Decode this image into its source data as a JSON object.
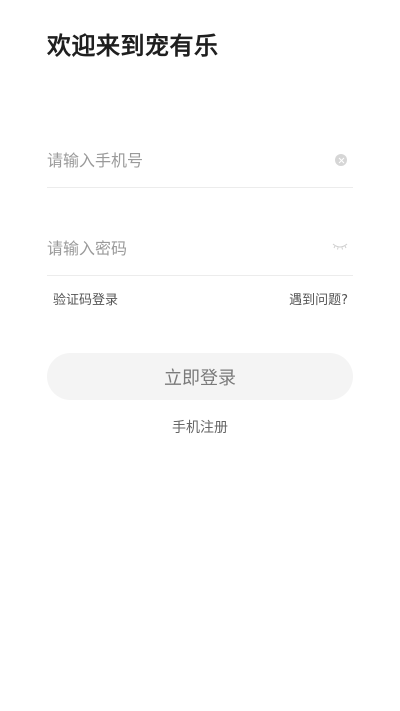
{
  "header": {
    "title": "欢迎来到宠有乐"
  },
  "form": {
    "phone": {
      "value": "",
      "placeholder": "请输入手机号",
      "clear_icon": "clear-circle-icon"
    },
    "password": {
      "value": "",
      "placeholder": "请输入密码",
      "toggle_icon": "eye-closed-icon"
    }
  },
  "links": {
    "sms_login": "验证码登录",
    "help": "遇到问题?"
  },
  "actions": {
    "login_label": "立即登录",
    "register_label": "手机注册"
  },
  "colors": {
    "background": "#ffffff",
    "title_text": "#1f1f1f",
    "placeholder_text": "#9a9a9a",
    "divider": "#ececec",
    "button_bg": "#f4f4f4",
    "button_text": "#7a7a7a",
    "link_text": "#555555"
  }
}
